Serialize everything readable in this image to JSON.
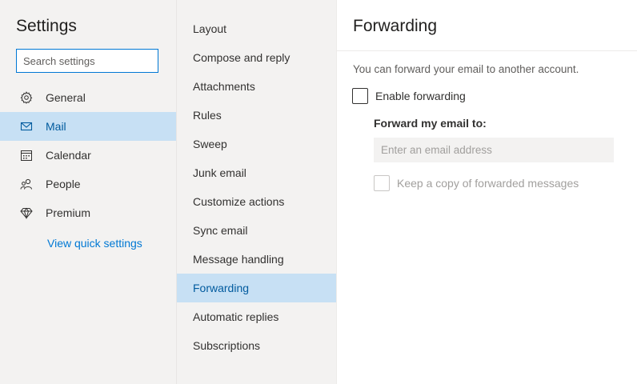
{
  "settings": {
    "title": "Settings",
    "search_placeholder": "Search settings"
  },
  "nav": {
    "items": [
      {
        "label": "General",
        "icon": "gear-icon",
        "selected": false
      },
      {
        "label": "Mail",
        "icon": "mail-icon",
        "selected": true
      },
      {
        "label": "Calendar",
        "icon": "calendar-icon",
        "selected": false
      },
      {
        "label": "People",
        "icon": "people-icon",
        "selected": false
      },
      {
        "label": "Premium",
        "icon": "diamond-icon",
        "selected": false
      }
    ],
    "quick_settings_link": "View quick settings"
  },
  "mail_sections": {
    "items": [
      {
        "label": "Layout",
        "selected": false
      },
      {
        "label": "Compose and reply",
        "selected": false
      },
      {
        "label": "Attachments",
        "selected": false
      },
      {
        "label": "Rules",
        "selected": false
      },
      {
        "label": "Sweep",
        "selected": false
      },
      {
        "label": "Junk email",
        "selected": false
      },
      {
        "label": "Customize actions",
        "selected": false
      },
      {
        "label": "Sync email",
        "selected": false
      },
      {
        "label": "Message handling",
        "selected": false
      },
      {
        "label": "Forwarding",
        "selected": true
      },
      {
        "label": "Automatic replies",
        "selected": false
      },
      {
        "label": "Subscriptions",
        "selected": false
      }
    ]
  },
  "forwarding": {
    "title": "Forwarding",
    "description": "You can forward your email to another account.",
    "enable_label": "Enable forwarding",
    "enable_checked": false,
    "forward_to_label": "Forward my email to:",
    "email_placeholder": "Enter an email address",
    "email_value": "",
    "keep_copy_label": "Keep a copy of forwarded messages",
    "keep_copy_checked": false,
    "keep_copy_disabled": true
  },
  "colors": {
    "accent": "#0078d4",
    "selected_bg": "#c7e0f4",
    "selected_text": "#005a9e",
    "pane_bg": "#f3f2f1"
  }
}
